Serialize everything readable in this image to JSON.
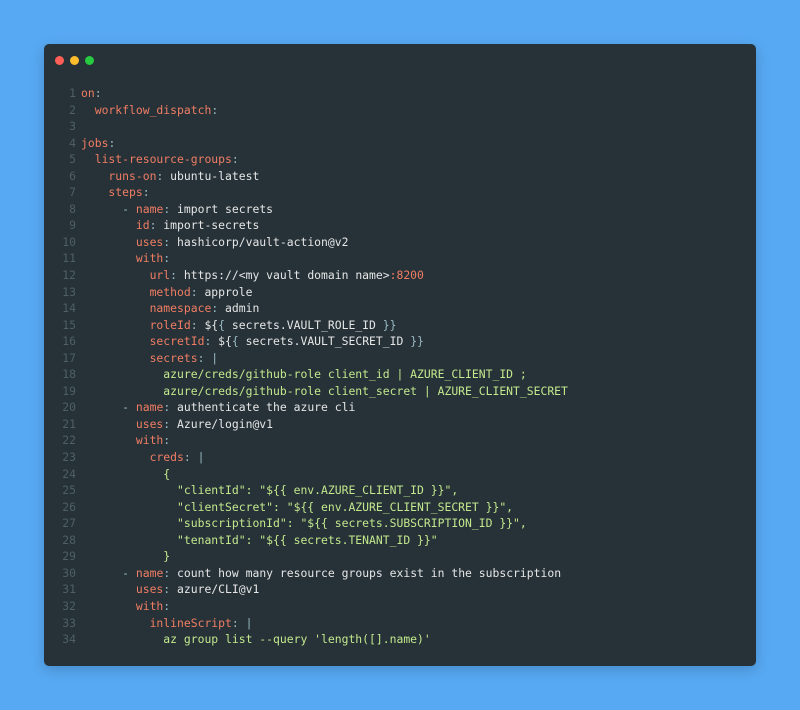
{
  "window": {
    "dots": [
      {
        "name": "close-dot",
        "color": "#ff5f56"
      },
      {
        "name": "minimize-dot",
        "color": "#ffbd2e"
      },
      {
        "name": "maximize-dot",
        "color": "#27c93f"
      }
    ]
  },
  "colors": {
    "background": "#57a9f3",
    "editor": "#263238",
    "key": "#f07d63",
    "punctuation": "#9bbac4",
    "value": "#e6e6e6",
    "string": "#c3e88d",
    "line_number": "#4f5f66"
  },
  "code_lines": [
    {
      "number": "1",
      "tokens": [
        {
          "t": "on",
          "c": "k"
        },
        {
          "t": ":",
          "c": "p"
        }
      ]
    },
    {
      "number": "2",
      "tokens": [
        {
          "t": "  workflow_dispatch",
          "c": "k"
        },
        {
          "t": ":",
          "c": "p"
        }
      ]
    },
    {
      "number": "3",
      "tokens": []
    },
    {
      "number": "4",
      "tokens": [
        {
          "t": "jobs",
          "c": "k"
        },
        {
          "t": ":",
          "c": "p"
        }
      ]
    },
    {
      "number": "5",
      "tokens": [
        {
          "t": "  list-resource-groups",
          "c": "k"
        },
        {
          "t": ":",
          "c": "p"
        }
      ]
    },
    {
      "number": "6",
      "tokens": [
        {
          "t": "    runs-on",
          "c": "k"
        },
        {
          "t": ": ",
          "c": "p"
        },
        {
          "t": "ubuntu-latest",
          "c": "v"
        }
      ]
    },
    {
      "number": "7",
      "tokens": [
        {
          "t": "    steps",
          "c": "k"
        },
        {
          "t": ":",
          "c": "p"
        }
      ]
    },
    {
      "number": "8",
      "tokens": [
        {
          "t": "      - ",
          "c": "p"
        },
        {
          "t": "name",
          "c": "k"
        },
        {
          "t": ": ",
          "c": "p"
        },
        {
          "t": "import secrets",
          "c": "v"
        }
      ]
    },
    {
      "number": "9",
      "tokens": [
        {
          "t": "        id",
          "c": "k"
        },
        {
          "t": ": ",
          "c": "p"
        },
        {
          "t": "import-secrets",
          "c": "v"
        }
      ]
    },
    {
      "number": "10",
      "tokens": [
        {
          "t": "        uses",
          "c": "k"
        },
        {
          "t": ": ",
          "c": "p"
        },
        {
          "t": "hashicorp/vault-action@v2",
          "c": "v"
        }
      ]
    },
    {
      "number": "11",
      "tokens": [
        {
          "t": "        with",
          "c": "k"
        },
        {
          "t": ":",
          "c": "p"
        }
      ]
    },
    {
      "number": "12",
      "tokens": [
        {
          "t": "          url",
          "c": "k"
        },
        {
          "t": ": ",
          "c": "p"
        },
        {
          "t": "https://<my vault domain name>",
          "c": "v"
        },
        {
          "t": ":8200",
          "c": "n"
        }
      ]
    },
    {
      "number": "13",
      "tokens": [
        {
          "t": "          method",
          "c": "k"
        },
        {
          "t": ": ",
          "c": "p"
        },
        {
          "t": "approle",
          "c": "v"
        }
      ]
    },
    {
      "number": "14",
      "tokens": [
        {
          "t": "          namespace",
          "c": "k"
        },
        {
          "t": ": ",
          "c": "p"
        },
        {
          "t": "admin",
          "c": "v"
        }
      ]
    },
    {
      "number": "15",
      "tokens": [
        {
          "t": "          roleId",
          "c": "k"
        },
        {
          "t": ": ",
          "c": "p"
        },
        {
          "t": "${",
          "c": "v"
        },
        {
          "t": "{",
          "c": "p"
        },
        {
          "t": " secrets.VAULT_ROLE_ID ",
          "c": "v"
        },
        {
          "t": "}}",
          "c": "p"
        }
      ]
    },
    {
      "number": "16",
      "tokens": [
        {
          "t": "          secretId",
          "c": "k"
        },
        {
          "t": ": ",
          "c": "p"
        },
        {
          "t": "${",
          "c": "v"
        },
        {
          "t": "{",
          "c": "p"
        },
        {
          "t": " secrets.VAULT_SECRET_ID ",
          "c": "v"
        },
        {
          "t": "}}",
          "c": "p"
        }
      ]
    },
    {
      "number": "17",
      "tokens": [
        {
          "t": "          secrets",
          "c": "k"
        },
        {
          "t": ": |",
          "c": "p"
        }
      ]
    },
    {
      "number": "18",
      "tokens": [
        {
          "t": "            azure/creds/github-role client_id | AZURE_CLIENT_ID ;",
          "c": "s"
        }
      ]
    },
    {
      "number": "19",
      "tokens": [
        {
          "t": "            azure/creds/github-role client_secret | AZURE_CLIENT_SECRET",
          "c": "s"
        }
      ]
    },
    {
      "number": "20",
      "tokens": [
        {
          "t": "      - ",
          "c": "p"
        },
        {
          "t": "name",
          "c": "k"
        },
        {
          "t": ": ",
          "c": "p"
        },
        {
          "t": "authenticate the azure cli",
          "c": "v"
        }
      ]
    },
    {
      "number": "21",
      "tokens": [
        {
          "t": "        uses",
          "c": "k"
        },
        {
          "t": ": ",
          "c": "p"
        },
        {
          "t": "Azure/login@v1",
          "c": "v"
        }
      ]
    },
    {
      "number": "22",
      "tokens": [
        {
          "t": "        with",
          "c": "k"
        },
        {
          "t": ":",
          "c": "p"
        }
      ]
    },
    {
      "number": "23",
      "tokens": [
        {
          "t": "          creds",
          "c": "k"
        },
        {
          "t": ": |",
          "c": "p"
        }
      ]
    },
    {
      "number": "24",
      "tokens": [
        {
          "t": "            {",
          "c": "s"
        }
      ]
    },
    {
      "number": "25",
      "tokens": [
        {
          "t": "              \"clientId\": \"${{ env.AZURE_CLIENT_ID }}\",",
          "c": "s"
        }
      ]
    },
    {
      "number": "26",
      "tokens": [
        {
          "t": "              \"clientSecret\": \"${{ env.AZURE_CLIENT_SECRET }}\",",
          "c": "s"
        }
      ]
    },
    {
      "number": "27",
      "tokens": [
        {
          "t": "              \"subscriptionId\": \"${{ secrets.SUBSCRIPTION_ID }}\",",
          "c": "s"
        }
      ]
    },
    {
      "number": "28",
      "tokens": [
        {
          "t": "              \"tenantId\": \"${{ secrets.TENANT_ID }}\"",
          "c": "s"
        }
      ]
    },
    {
      "number": "29",
      "tokens": [
        {
          "t": "            }",
          "c": "s"
        }
      ]
    },
    {
      "number": "30",
      "tokens": [
        {
          "t": "      - ",
          "c": "p"
        },
        {
          "t": "name",
          "c": "k"
        },
        {
          "t": ": ",
          "c": "p"
        },
        {
          "t": "count how many resource groups exist in the subscription",
          "c": "v"
        }
      ]
    },
    {
      "number": "31",
      "tokens": [
        {
          "t": "        uses",
          "c": "k"
        },
        {
          "t": ": ",
          "c": "p"
        },
        {
          "t": "azure/CLI@v1",
          "c": "v"
        }
      ]
    },
    {
      "number": "32",
      "tokens": [
        {
          "t": "        with",
          "c": "k"
        },
        {
          "t": ":",
          "c": "p"
        }
      ]
    },
    {
      "number": "33",
      "tokens": [
        {
          "t": "          inlineScript",
          "c": "k"
        },
        {
          "t": ": |",
          "c": "p"
        }
      ]
    },
    {
      "number": "34",
      "tokens": [
        {
          "t": "            az group list --query 'length([].name)'",
          "c": "s"
        }
      ]
    }
  ]
}
